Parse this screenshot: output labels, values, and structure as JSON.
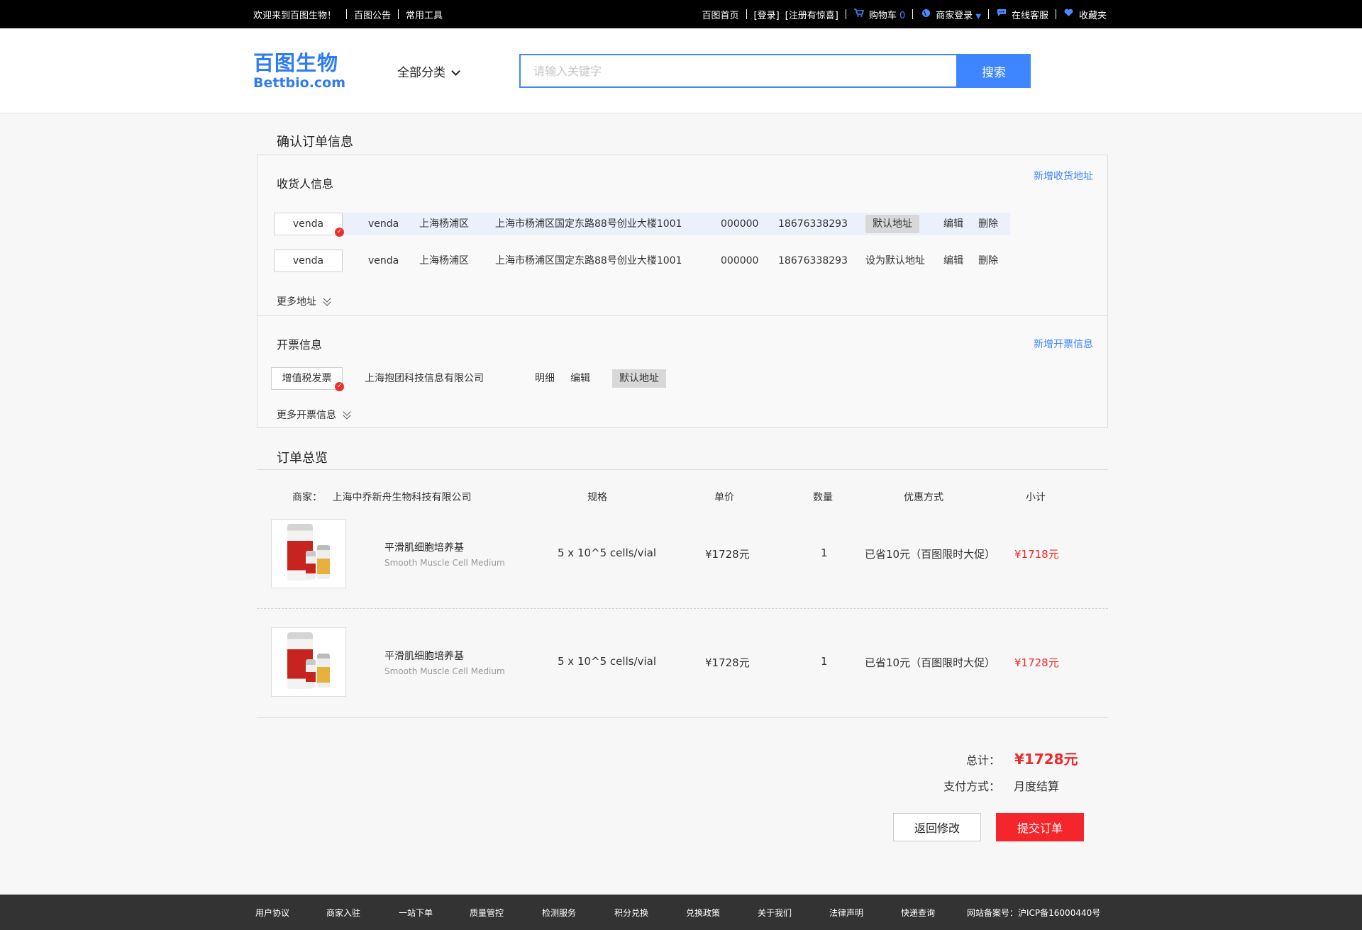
{
  "topbar": {
    "welcome": "欢迎来到百图生物！",
    "notice": "百图公告",
    "tools": "常用工具",
    "home": "百图首页",
    "login": "[登录]",
    "register": "[注册有惊喜]",
    "cart_label": "购物车",
    "cart_count": "0",
    "merchant_login": "商家登录",
    "service": "在线客服",
    "favorites": "收藏夹"
  },
  "header": {
    "logo_cn": "百图生物",
    "logo_en": "Bettbio.com",
    "category_label": "全部分类",
    "search_placeholder": "请输入关键字",
    "search_button": "搜索"
  },
  "confirm": {
    "title": "确认订单信息",
    "receiver_title": "收货人信息",
    "add_address": "新增收货地址",
    "addresses": [
      {
        "tag": "venda",
        "name": "venda",
        "district": "上海杨浦区",
        "address": "上海市杨浦区国定东路88号创业大楼1001",
        "zip": "000000",
        "phone": "18676338293",
        "default_label": "默认地址",
        "edit": "编辑",
        "delete": "删除"
      },
      {
        "tag": "venda",
        "name": "venda",
        "district": "上海杨浦区",
        "address": "上海市杨浦区国定东路88号创业大楼1001",
        "zip": "000000",
        "phone": "18676338293",
        "default_label": "设为默认地址",
        "edit": "编辑",
        "delete": "删除"
      }
    ],
    "more_addresses": "更多地址",
    "invoice_title": "开票信息",
    "add_invoice": "新增开票信息",
    "invoice": {
      "type": "增值税发票",
      "company": "上海抱团科技信息有限公司",
      "detail": "明细",
      "edit": "编辑",
      "default_label": "默认地址"
    },
    "more_invoices": "更多开票信息"
  },
  "overview": {
    "title": "订单总览",
    "merchant_label": "商家：",
    "merchant_name": "上海中乔新舟生物科技有限公司",
    "headers": {
      "spec": "规格",
      "price": "单价",
      "qty": "数量",
      "discount": "优惠方式",
      "subtotal": "小计"
    },
    "items": [
      {
        "name": "平滑肌细胞培养基",
        "name_en": "Smooth Muscle Cell Medium",
        "spec": "5 x 10^5 cells/vial",
        "price": "¥1728元",
        "qty": "1",
        "discount": "已省10元（百图限时大促）",
        "subtotal": "¥1718元"
      },
      {
        "name": "平滑肌细胞培养基",
        "name_en": "Smooth Muscle Cell Medium",
        "spec": "5 x 10^5 cells/vial",
        "price": "¥1728元",
        "qty": "1",
        "discount": "已省10元（百图限时大促）",
        "subtotal": "¥1728元"
      }
    ]
  },
  "summary": {
    "total_label": "总计：",
    "total_value": "¥1728元",
    "payment_label": "支付方式：",
    "payment_value": "月度结算",
    "back_button": "返回修改",
    "submit_button": "提交订单"
  },
  "footer": {
    "items": [
      "用户协议",
      "商家入驻",
      "一站下单",
      "质量管控",
      "检测服务",
      "积分兑换",
      "兑换政策",
      "关于我们",
      "法律声明",
      "快递查询"
    ],
    "icp": "网站备案号：沪ICP备16000440号"
  },
  "colors": {
    "accent": "#3e86ff",
    "price_red": "#ee2a2a",
    "submit_red": "#f5252c"
  }
}
